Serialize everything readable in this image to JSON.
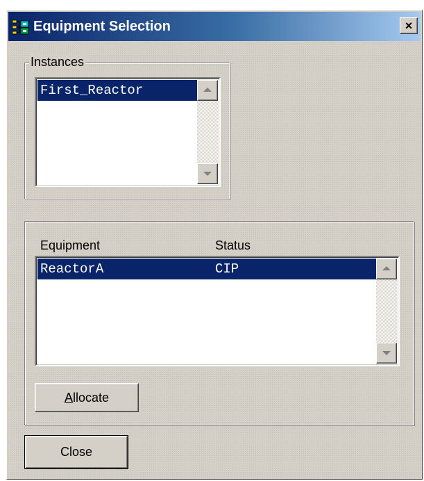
{
  "window": {
    "title": "Equipment Selection",
    "icon": "equipment-app-icon",
    "close_glyph": "×"
  },
  "instances": {
    "group_label": "Instances",
    "items": [
      "First_Reactor"
    ],
    "selected_index": 0
  },
  "equipment": {
    "columns": {
      "equipment": "Equipment",
      "status": "Status"
    },
    "rows": [
      {
        "equipment": "ReactorA",
        "status": "CIP"
      }
    ],
    "selected_index": 0,
    "allocate_label": {
      "mnemonic": "A",
      "rest": "llocate"
    }
  },
  "close_label": "Close",
  "colors": {
    "face": "#d4d0c8",
    "selection": "#0a246a",
    "title_gradient_start": "#0a246a",
    "title_gradient_end": "#a6caf0"
  }
}
